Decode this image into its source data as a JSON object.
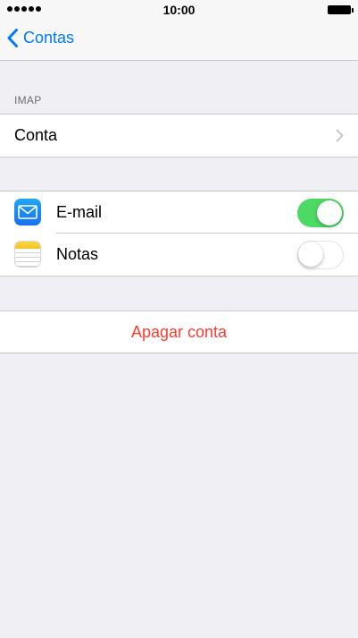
{
  "status_bar": {
    "time": "10:00"
  },
  "nav": {
    "back_label": "Contas"
  },
  "section": {
    "header": "IMAP"
  },
  "account_row": {
    "label": "Conta"
  },
  "services": [
    {
      "label": "E-mail",
      "icon": "mail-icon",
      "enabled": true
    },
    {
      "label": "Notas",
      "icon": "notes-icon",
      "enabled": false
    }
  ],
  "delete": {
    "label": "Apagar conta"
  },
  "colors": {
    "accent": "#007aff",
    "toggle_on": "#4cd964",
    "destructive": "#ff3b30",
    "background": "#efeff4"
  }
}
